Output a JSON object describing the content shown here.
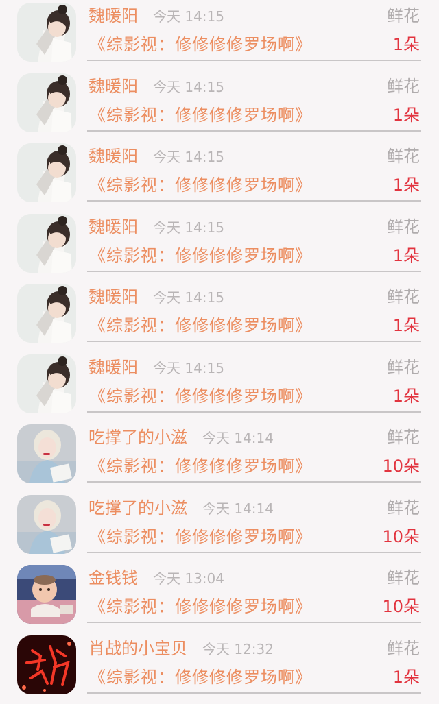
{
  "colors": {
    "name": "#ec8e61",
    "title": "#ec8e61",
    "count": "#e2343f",
    "time": "#b9b5b6",
    "gift": "#b0acad"
  },
  "items": [
    {
      "name": "魏暖阳",
      "time": "今天 14:15",
      "gift": "鲜花",
      "title": "《综影视：修修修修罗场啊》",
      "count": "1朵",
      "avatar": "girl-sleeping-avatar"
    },
    {
      "name": "魏暖阳",
      "time": "今天 14:15",
      "gift": "鲜花",
      "title": "《综影视：修修修修罗场啊》",
      "count": "1朵",
      "avatar": "girl-sleeping-avatar"
    },
    {
      "name": "魏暖阳",
      "time": "今天 14:15",
      "gift": "鲜花",
      "title": "《综影视：修修修修罗场啊》",
      "count": "1朵",
      "avatar": "girl-sleeping-avatar"
    },
    {
      "name": "魏暖阳",
      "time": "今天 14:15",
      "gift": "鲜花",
      "title": "《综影视：修修修修罗场啊》",
      "count": "1朵",
      "avatar": "girl-sleeping-avatar"
    },
    {
      "name": "魏暖阳",
      "time": "今天 14:15",
      "gift": "鲜花",
      "title": "《综影视：修修修修罗场啊》",
      "count": "1朵",
      "avatar": "girl-sleeping-avatar"
    },
    {
      "name": "魏暖阳",
      "time": "今天 14:15",
      "gift": "鲜花",
      "title": "《综影视：修修修修罗场啊》",
      "count": "1朵",
      "avatar": "girl-sleeping-avatar"
    },
    {
      "name": "吃撑了的小滋",
      "time": "今天 14:14",
      "gift": "鲜花",
      "title": "《综影视：修修修修罗场啊》",
      "count": "10朵",
      "avatar": "blonde-girl-avatar"
    },
    {
      "name": "吃撑了的小滋",
      "time": "今天 14:14",
      "gift": "鲜花",
      "title": "《综影视：修修修修罗场啊》",
      "count": "10朵",
      "avatar": "blonde-girl-avatar"
    },
    {
      "name": "金钱钱",
      "time": "今天 13:04",
      "gift": "鲜花",
      "title": "《综影视：修修修修罗场啊》",
      "count": "10朵",
      "avatar": "baby-avatar"
    },
    {
      "name": "肖战的小宝贝",
      "time": "今天 12:32",
      "gift": "鲜花",
      "title": "《综影视：修修修修罗场啊》",
      "count": "1朵",
      "avatar": "red-neon-character-avatar"
    }
  ]
}
